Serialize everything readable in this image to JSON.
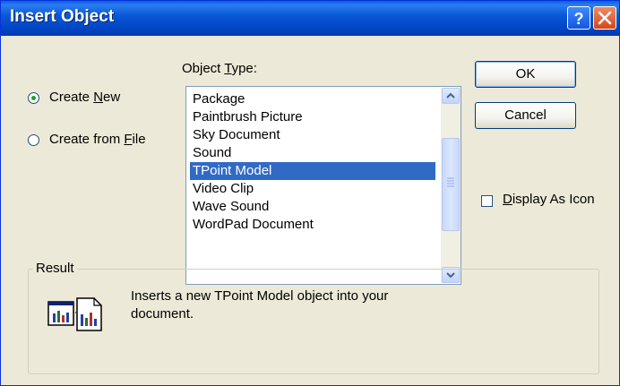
{
  "window": {
    "title": "Insert Object",
    "help_icon": "question-mark-icon",
    "close_icon": "close-x-icon",
    "titlebar_color": "#0a5ad6",
    "close_color": "#d2481c"
  },
  "source": {
    "create_new": {
      "pre": "Create ",
      "key": "N",
      "post": "ew",
      "checked": true
    },
    "create_from_file": {
      "pre": "Create from ",
      "key": "F",
      "post": "ile",
      "checked": false
    }
  },
  "object_type": {
    "label_pre": "Object ",
    "label_key": "T",
    "label_post": "ype:",
    "items": [
      "Package",
      "Paintbrush Picture",
      "Sky Document",
      "Sound",
      "TPoint Model",
      "Video Clip",
      "Wave Sound",
      "WordPad Document"
    ],
    "selected": "TPoint Model",
    "selection_color": "#316ac5",
    "scroll_up_icon": "chevron-up-icon",
    "scroll_down_icon": "chevron-down-icon"
  },
  "buttons": {
    "ok": "OK",
    "cancel": "Cancel"
  },
  "display_as_icon": {
    "key": "D",
    "post": "isplay As Icon",
    "checked": false
  },
  "result": {
    "title": "Result",
    "text": "Inserts a new TPoint Model object into your document.",
    "icon": "tpoint-model-object-icon"
  }
}
